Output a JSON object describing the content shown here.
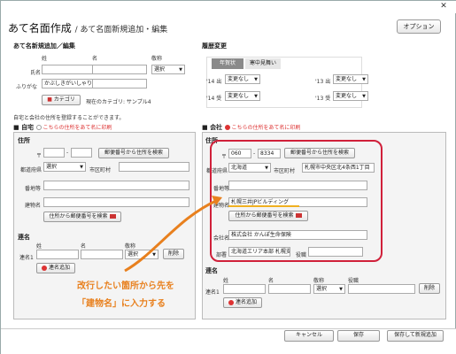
{
  "window": {
    "close_label": "✕"
  },
  "header": {
    "title": "あて名面作成",
    "subtitle": "/ あて名面新規追加・編集",
    "option_label": "オプション"
  },
  "addressee": {
    "section_title": "あて名新規追加／編集",
    "col_last": "姓",
    "col_first": "名",
    "col_honorific": "敬称",
    "name_label": "氏名",
    "furigana_label": "ふりがな",
    "furigana_value": "かぶしきがいしゃり",
    "honorific_value": "選択",
    "category_button": "カテゴリ",
    "category_text": "現在のカテゴリ: サンプル4"
  },
  "history": {
    "section_title": "履歴変更",
    "tab_nenga": "年賀状",
    "tab_kanchu": "寒中見舞い",
    "rows": [
      {
        "year": "'14",
        "dir": "出",
        "value": "変更なし"
      },
      {
        "year": "'13",
        "dir": "出",
        "value": "変更なし"
      },
      {
        "year": "'14",
        "dir": "受",
        "value": "変更なし"
      },
      {
        "year": "'13",
        "dir": "受",
        "value": "変更なし"
      }
    ]
  },
  "notice": "自宅と会社の住所を登録することができます。",
  "home": {
    "label": "自宅",
    "print_label": "こちらの住所をあて名に印刷",
    "address_title": "住所",
    "postal_mark": "〒",
    "search_button": "郵便番号から住所を検索",
    "prefecture_label": "都道府県",
    "prefecture_value": "選択",
    "city_label": "市区町村",
    "banchi_label": "番地等",
    "building_label": "建物名",
    "reverse_button": "住所から郵便番号を検索",
    "joint_title": "連名",
    "col_last": "姓",
    "col_first": "名",
    "col_honorific": "敬称",
    "joint1_label": "連名1",
    "honorific_value": "選択",
    "delete_button": "削除",
    "add_button": "連名追加"
  },
  "company": {
    "label": "会社",
    "print_label": "こちらの住所をあて名に印刷",
    "address_title": "住所",
    "postal_mark": "〒",
    "postal1": "060",
    "postal2": "8334",
    "search_button": "郵便番号から住所を検索",
    "prefecture_label": "都道府県",
    "prefecture_value": "北海道",
    "city_label": "市区町村",
    "city_value": "札幌市中央区北4条西1丁目",
    "banchi_label": "番地等",
    "building_label": "建物名",
    "building_value": "札幌三井JPビルディング",
    "reverse_button": "住所から郵便番号を検索",
    "company_label": "会社名",
    "company_value": "株式会社 かんぽ生命保険",
    "dept_label": "部署",
    "dept_value": "北海道エリア本部 札幌支",
    "position_label": "役職",
    "joint_title": "連名",
    "col_last": "姓",
    "col_first": "名",
    "col_honorific": "敬称",
    "col_position": "役職",
    "joint1_label": "連名1",
    "honorific_value": "選択",
    "delete_button": "削除",
    "add_button": "連名追加"
  },
  "callout": {
    "line1": "改行したい箇所から先を",
    "line2": "「建物名」に入力する"
  },
  "footer": {
    "cancel": "キャンセル",
    "save": "保存",
    "save_new": "保存して新規追加"
  },
  "colors": {
    "accent_red": "#d0203a",
    "callout_orange": "#e8801e"
  }
}
